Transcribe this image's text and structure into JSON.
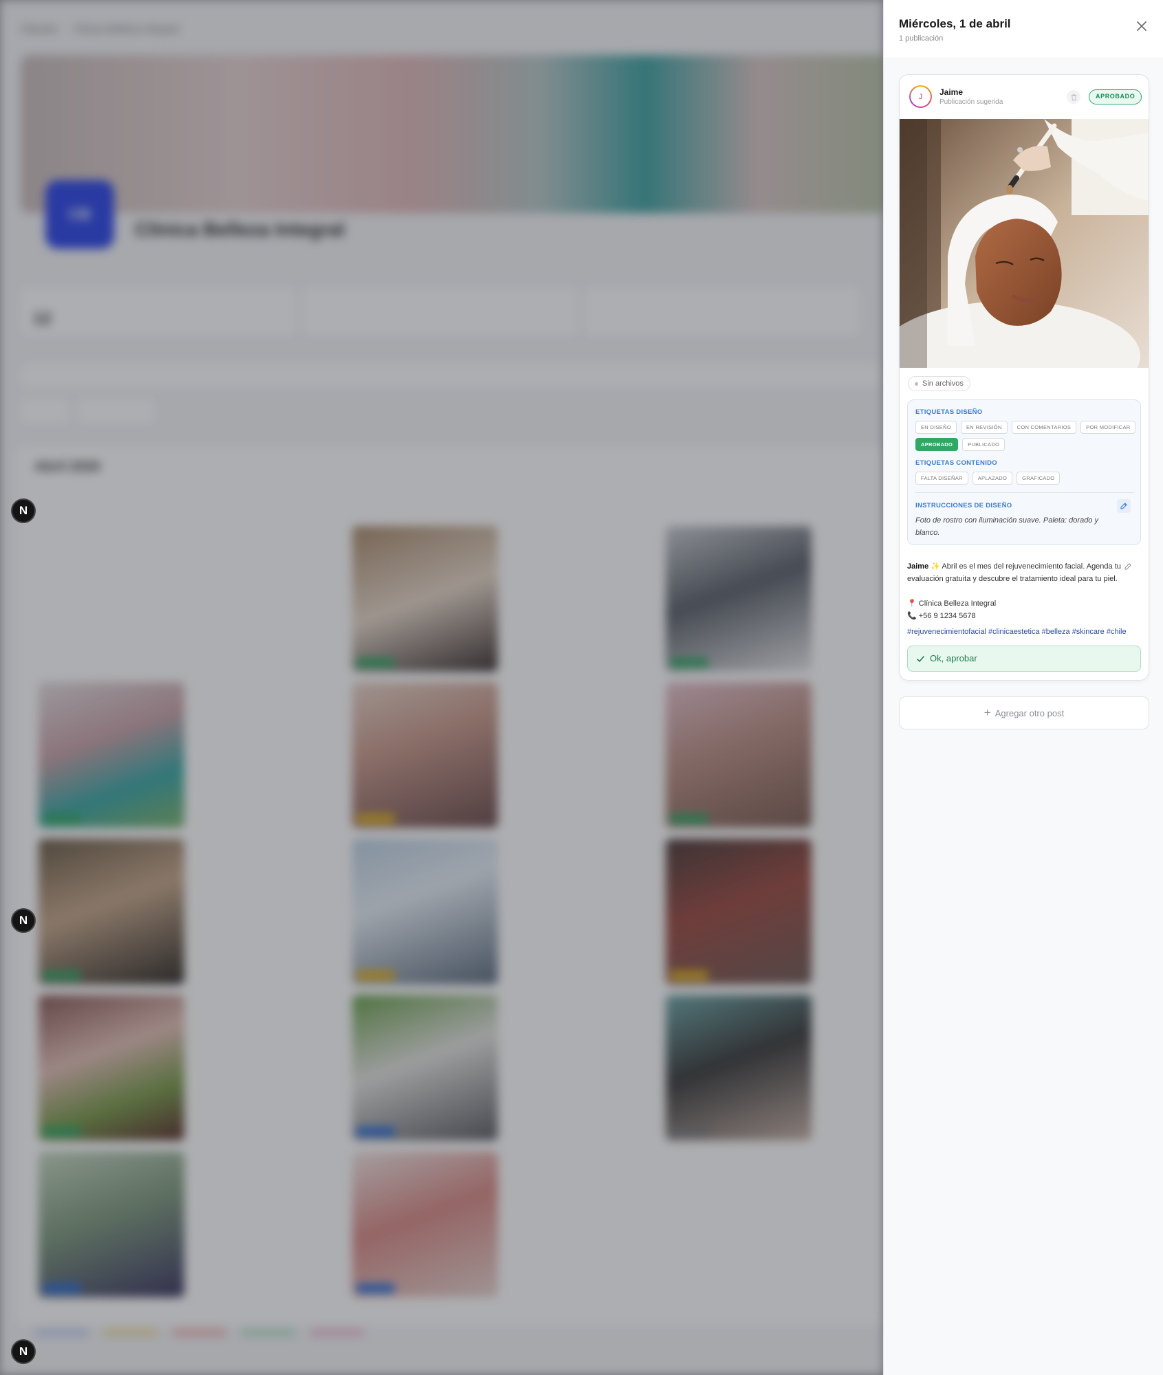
{
  "background": {
    "breadcrumb": [
      "Clientes",
      "Clínica Belleza Integral"
    ],
    "logo_text": "CB",
    "clinic_name": "Clínica Belleza Integral",
    "stat_values": [
      "12",
      "",
      ""
    ],
    "calendar_title": "Abril 2026"
  },
  "drawer": {
    "title": "Miércoles, 1 de abril",
    "subtitle": "1 publicación",
    "close_label": "×",
    "post": {
      "avatar_initial": "J",
      "author": "Jaime",
      "author_sub": "Publicación sugerida",
      "status": "APROBADO",
      "files_chip": "Sin archivos",
      "design_tags_label": "ETIQUETAS DISEÑO",
      "design_tags": [
        "EN DISEÑO",
        "EN REVISIÓN",
        "CON COMENTARIOS",
        "POR MODIFICAR",
        "APROBADO",
        "PUBLICADO"
      ],
      "content_tags_label": "ETIQUETAS CONTENIDO",
      "content_tags": [
        "FALTA DISEÑAR",
        "APLAZADO",
        "GRAFICADO"
      ],
      "instructions_label": "INSTRUCCIONES DE DISEÑO",
      "instructions": "Foto de rostro con iluminación suave. Paleta: dorado y blanco.",
      "caption_author": "Jaime",
      "caption_text": "✨ Abril es el mes del rejuvenecimiento facial. Agenda tu evaluación gratuita y descubre el tratamiento ideal para tu piel.",
      "location_line": "📍 Clínica Belleza Integral",
      "phone_line": "📞 +56 9 1234 5678",
      "hashtags": "#rejuvenecimientofacial #clinicaestetica #belleza #skincare #chile",
      "approve_label": "Ok, aprobar"
    },
    "add_post_label": "Agregar otro post"
  },
  "colors": {
    "approved_green": "#2fa864",
    "tag_blue": "#3a7bd5",
    "hashtag_blue": "#2b4aa8",
    "logo_blue": "#2b45e8"
  }
}
